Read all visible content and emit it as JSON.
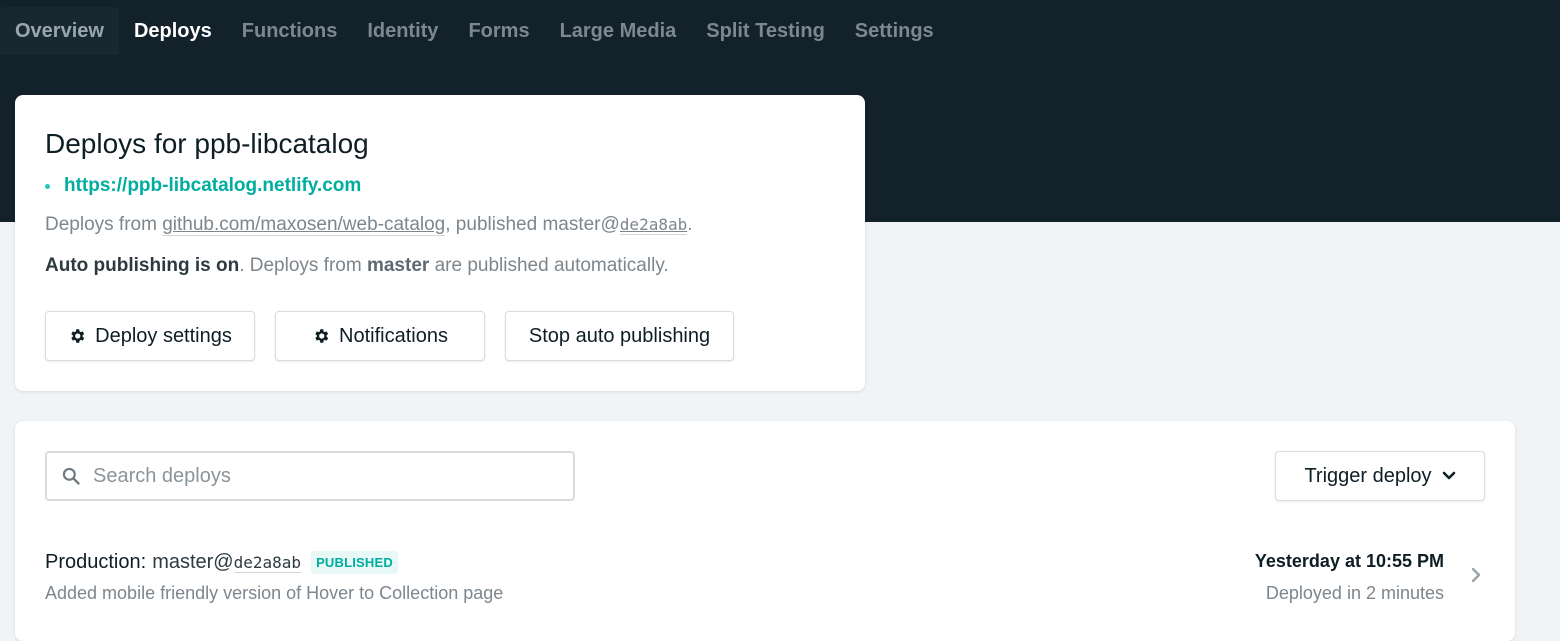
{
  "nav": {
    "tabs": [
      {
        "label": "Overview"
      },
      {
        "label": "Deploys"
      },
      {
        "label": "Functions"
      },
      {
        "label": "Identity"
      },
      {
        "label": "Forms"
      },
      {
        "label": "Large Media"
      },
      {
        "label": "Split Testing"
      },
      {
        "label": "Settings"
      }
    ],
    "active_tab": "Deploys"
  },
  "site": {
    "title": "Deploys for ppb-libcatalog",
    "url": "https://ppb-libcatalog.netlify.com",
    "deploys_from_prefix": "Deploys from ",
    "repo": "github.com/maxosen/web-catalog",
    "published_text": ", published ",
    "branch": "master@",
    "commit": "de2a8ab",
    "period": ".",
    "auto_publishing_label": "Auto publishing is on",
    "auto_publishing_text_1": ". Deploys from ",
    "auto_publishing_branch": "master",
    "auto_publishing_text_2": " are published automatically.",
    "buttons": {
      "deploy_settings": "Deploy settings",
      "notifications": "Notifications",
      "stop_auto_publishing": "Stop auto publishing"
    }
  },
  "deploys": {
    "search_placeholder": "Search deploys",
    "trigger_label": "Trigger deploy",
    "rows": [
      {
        "context": "Production",
        "separator": ":",
        "branch": "master@",
        "commit": "de2a8ab",
        "status": "PUBLISHED",
        "message": "Added mobile friendly version of Hover to Collection page",
        "time": "Yesterday at 10:55 PM",
        "duration": "Deployed in 2 minutes"
      }
    ]
  },
  "colors": {
    "header_bg": "#12212a",
    "accent": "#00ad9f",
    "page_bg": "#f1f4f7"
  },
  "icons": [
    "gear-icon",
    "search-icon",
    "chevron-down-icon",
    "chevron-right-icon"
  ]
}
